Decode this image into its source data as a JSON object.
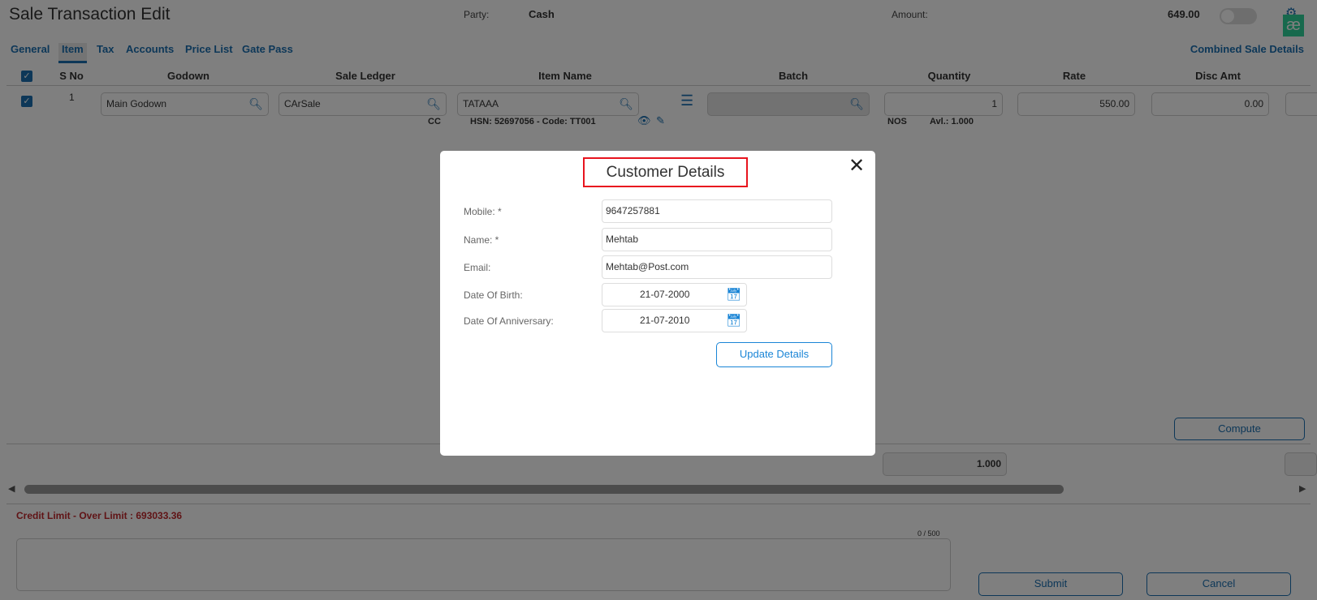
{
  "header": {
    "title": "Sale Transaction Edit",
    "party_label": "Party:",
    "party_value": "Cash",
    "amount_label": "Amount:",
    "amount_value": "649.00",
    "logo_text": "æ"
  },
  "tabs": [
    {
      "label": "General"
    },
    {
      "label": "Item",
      "active": true
    },
    {
      "label": "Tax"
    },
    {
      "label": "Accounts"
    },
    {
      "label": "Price List"
    },
    {
      "label": "Gate Pass"
    }
  ],
  "combined_link": "Combined Sale Details",
  "columns": [
    "S No",
    "Godown",
    "Sale Ledger",
    "Item Name",
    "Batch",
    "Quantity",
    "Rate",
    "Disc Amt"
  ],
  "row": {
    "sno": "1",
    "godown": "Main Godown",
    "sale_ledger": "CArSale",
    "cc": "CC",
    "item_name": "TATAAA",
    "hsn": "HSN: 52697056 - Code: TT001",
    "batch": "",
    "quantity": "1",
    "unit": "NOS",
    "available": "Avl.: 1.000",
    "rate": "550.00",
    "disc_amt": "0.00"
  },
  "compute_label": "Compute",
  "total_quantity": "1.000",
  "credit_limit": "Credit Limit - Over Limit : 693033.36",
  "remarks": {
    "counter": "0 / 500",
    "value": ""
  },
  "submit_label": "Submit",
  "cancel_label": "Cancel",
  "modal": {
    "title": "Customer Details",
    "mobile_label": "Mobile: *",
    "mobile": "9647257881",
    "name_label": "Name: *",
    "name": "Mehtab",
    "email_label": "Email:",
    "email": "Mehtab@Post.com",
    "dob_label": "Date Of Birth:",
    "dob": "21-07-2000",
    "doa_label": "Date Of Anniversary:",
    "doa": "21-07-2010",
    "update_label": "Update Details"
  },
  "colors": {
    "accent": "#1a6fb0",
    "error": "#c0282d",
    "highlight": "#e8141e",
    "logo": "#2fd39a"
  }
}
